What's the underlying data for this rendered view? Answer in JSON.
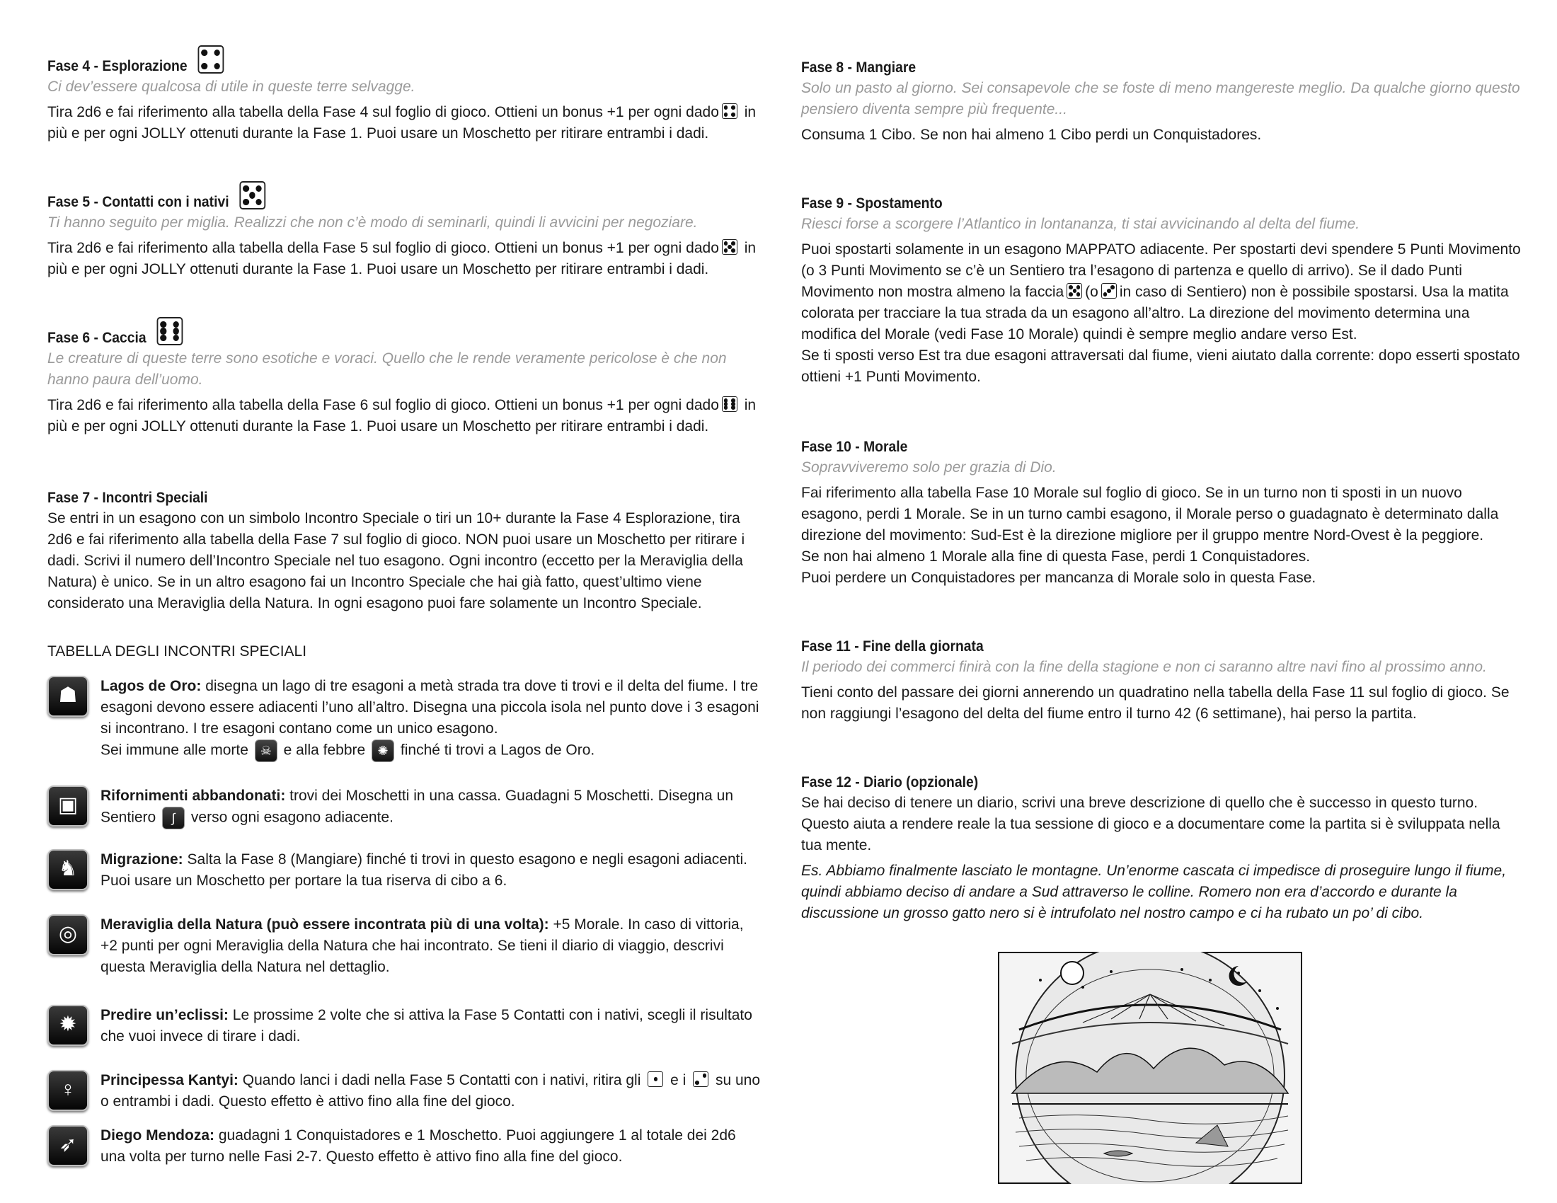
{
  "left": {
    "f4": {
      "title": "Fase 4 - Esplorazione",
      "quote": "Ci dev’essere qualcosa di utile in queste terre selvagge.",
      "body_a": "Tira 2d6 e fai riferimento alla tabella della Fase 4 sul foglio di gioco. Ottieni un bonus +1 per ogni dado",
      "body_b": "in",
      "body_c": "più e per ogni JOLLY ottenuti durante la Fase 1. Puoi usare un Moschetto per ritirare entrambi i dadi."
    },
    "f5": {
      "title": "Fase 5 - Contatti con i nativi",
      "quote": "Ti hanno seguito per miglia. Realizzi che non c’è modo di seminarli, quindi li avvicini per negoziare.",
      "body_a": "Tira 2d6 e fai riferimento alla tabella della Fase 5 sul foglio di gioco. Ottieni un bonus +1 per ogni dado",
      "body_b": "in",
      "body_c": "più e per ogni JOLLY ottenuti durante la Fase 1. Puoi usare un Moschetto per ritirare entrambi i dadi."
    },
    "f6": {
      "title": "Fase 6 - Caccia",
      "quote": "Le creature di queste terre sono esotiche e voraci. Quello che le rende veramente pericolose è che non hanno paura dell’uomo.",
      "body_a": "Tira 2d6 e fai riferimento alla tabella della Fase 6 sul foglio di gioco. Ottieni un bonus +1 per ogni dado",
      "body_b": "in",
      "body_c": "più e per ogni JOLLY ottenuti durante la Fase 1. Puoi usare un Moschetto per ritirare entrambi i dadi."
    },
    "f7": {
      "title": "Fase 7 - Incontri Speciali",
      "body": "Se entri in un esagono con un simbolo Incontro Speciale o tiri un 10+ durante la Fase 4 Esplorazione, tira 2d6 e fai riferimento alla tabella della Fase 7 sul foglio di gioco. NON puoi usare un Moschetto per ritirare i dadi. Scrivi il numero dell’Incontro Speciale nel tuo esagono. Ogni incontro (eccetto per la Meraviglia della Natura) è unico. Se in un altro esagono fai un Incontro Speciale che hai già fatto, quest’ultimo viene considerato una Meraviglia della Natura. In ogni esagono puoi fare solamente un Incontro Speciale."
    },
    "table_title": "TABELLA DEGLI INCONTRI SPECIALI",
    "encounters": [
      {
        "name": "Lagos de Oro:",
        "text": "disegna un lago di tre esagoni a metà strada tra dove ti trovi e il delta del fiume. I tre esagoni devono essere adiacenti l’uno all’altro. Disegna una piccola isola nel punto dove i 3 esagoni si incontrano. I tre esagoni contano come un unico esagono.",
        "extra_a": "Sei immune alle morte",
        "extra_b": "e alla febbre",
        "extra_c": "finché ti trovi a Lagos de Oro."
      },
      {
        "name": "Rifornimenti abbandonati:",
        "text": "trovi dei Moschetti in una cassa. Guadagni 5 Moschetti. Disegna un",
        "extra_a": "Sentiero",
        "extra_b": "verso ogni esagono adiacente."
      },
      {
        "name": "Migrazione:",
        "text": "Salta la Fase 8 (Mangiare) finché ti trovi in questo esagono e negli esagoni adiacenti. Puoi usare un Moschetto per portare la tua riserva di cibo a 6."
      },
      {
        "name": "Meraviglia della Natura (può essere incontrata più di una volta):",
        "text": "+5 Morale. In caso di vittoria, +2 punti per ogni Meraviglia della Natura che hai incontrato. Se tieni il diario di viaggio, descrivi questa Meraviglia della Natura nel dettaglio."
      },
      {
        "name": "Predire un’eclissi:",
        "text": "Le prossime 2 volte che si attiva la Fase 5 Contatti con i nativi, scegli il risultato che vuoi invece di tirare i dadi."
      },
      {
        "name": "Principessa Kantyi:",
        "text": "Quando lanci i dadi nella Fase 5 Contatti con i nativi, ritira gli",
        "extra_a": "e i",
        "extra_b": "su uno o entrambi i dadi. Questo effetto è attivo fino alla fine del gioco."
      },
      {
        "name": "Diego Mendoza:",
        "text": "guadagni 1 Conquistadores e 1 Moschetto. Puoi aggiungere 1 al totale dei 2d6 una volta per turno nelle Fasi 2-7. Questo effetto è attivo fino alla fine del gioco."
      }
    ]
  },
  "right": {
    "f8": {
      "title": "Fase 8 - Mangiare",
      "quote": "Solo un pasto al giorno. Sei consapevole che se foste di meno mangereste meglio. Da qualche giorno questo pensiero diventa sempre più frequente...",
      "body": "Consuma 1 Cibo. Se non hai almeno 1 Cibo perdi un Conquistadores."
    },
    "f9": {
      "title": "Fase 9 - Spostamento",
      "quote": "Riesci forse a scorgere l’Atlantico in lontananza, ti stai avvicinando al delta del fiume.",
      "body_a": "Puoi spostarti solamente in un esagono MAPPATO adiacente. Per spostarti devi spendere 5 Punti Movimento (o 3 Punti Movimento se c’è un Sentiero tra l’esagono di partenza e quello di arrivo). Se il dado Punti Movimento non mostra almeno la faccia",
      "body_b": "(o",
      "body_c": "in caso di Sentiero) non è possibile spostarsi. Usa la matita colorata per tracciare la tua strada da un esagono all’altro. La direzione del movimento determina una modifica del Morale (vedi Fase 10 Morale) quindi è sempre meglio andare verso Est.",
      "body_d": "Se ti sposti verso Est tra due esagoni attraversati dal fiume, vieni aiutato dalla corrente: dopo esserti spostato ottieni +1 Punti Movimento."
    },
    "f10": {
      "title": "Fase 10 - Morale",
      "quote": "Sopravviveremo solo per grazia di Dio.",
      "body_a": "Fai riferimento alla tabella Fase 10 Morale sul foglio di gioco. Se in un turno non ti sposti in un nuovo esagono, perdi 1 Morale. Se in un turno cambi esagono, il Morale perso o guadagnato è determinato dalla direzione del movimento: Sud-Est è la direzione migliore per il gruppo mentre Nord-Ovest è la peggiore.",
      "body_b": "Se non hai almeno 1 Morale alla fine di questa Fase, perdi 1 Conquistadores.",
      "body_c": "Puoi perdere un Conquistadores per mancanza di Morale solo in questa Fase."
    },
    "f11": {
      "title": "Fase 11 - Fine della giornata",
      "quote": "Il periodo dei commerci finirà con la fine della stagione e non ci saranno altre navi fino al prossimo anno.",
      "body": "Tieni conto del passare dei giorni annerendo un quadratino nella tabella della Fase 11 sul foglio di gioco. Se non raggiungi l’esagono del delta del fiume entro il turno 42 (6 settimane), hai perso la partita."
    },
    "f12": {
      "title": "Fase 12 - Diario (opzionale)",
      "body": "Se hai deciso di tenere un diario, scrivi una breve descrizione di quello che è successo in questo turno. Questo aiuta a rendere reale la tua sessione di gioco e a documentare come la partita si è sviluppata nella tua mente.",
      "example": "Es. Abbiamo finalmente lasciato le montagne. Un’enorme cascata ci impedisce di proseguire lungo il fiume, quindi abbiamo deciso di andare a Sud attraverso le colline. Romero non era d’accordo e durante la discussione un grosso gatto nero si è intrufolato nel nostro campo e ci ha rubato un po’ di cibo."
    }
  },
  "icons": {
    "encounter_icons": [
      "lake-icon",
      "crate-icon",
      "deer-icon",
      "globe-icon",
      "eclipse-icon",
      "princess-icon",
      "musketeer-icon"
    ],
    "inline_icons": [
      "skull-icon",
      "fever-icon",
      "path-icon"
    ]
  }
}
